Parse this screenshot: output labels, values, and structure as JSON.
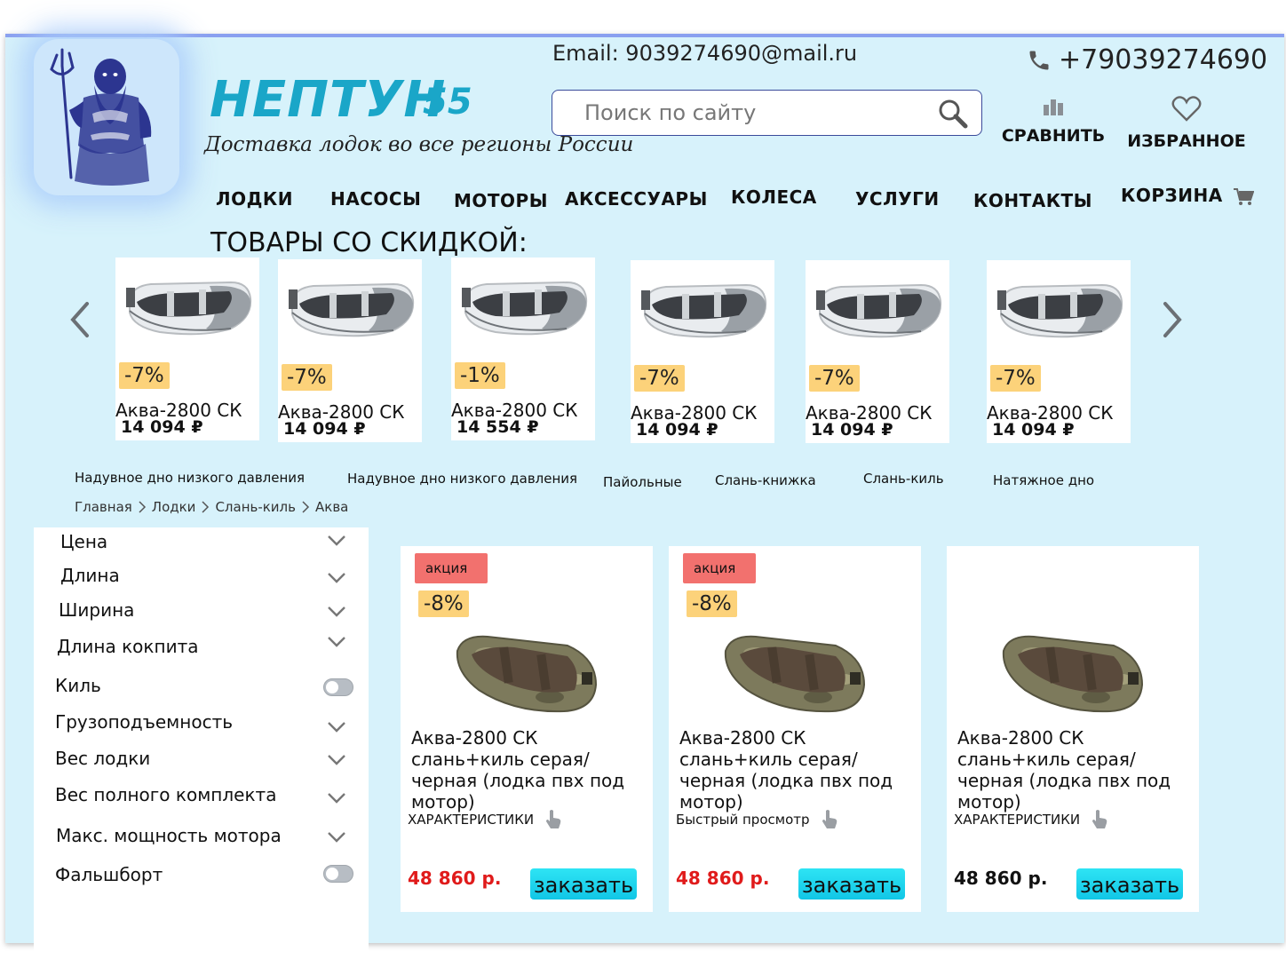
{
  "header": {
    "brand": "НЕПТУН",
    "brand_num": "55",
    "tagline": "Доставка лодок во все регионы России",
    "email": "Email: 9039274690@mail.ru",
    "phone": "+79039274690",
    "search_placeholder": "Поиск по сайту",
    "compare_label": "СРАВНИТЬ",
    "favorites_label": "ИЗБРАННОЕ"
  },
  "nav": {
    "items": [
      "ЛОДКИ",
      "НАСОСЫ",
      "МОТОРЫ",
      "АКСЕССУАРЫ",
      "КОЛЕСА",
      "УСЛУГИ",
      "КОНТАКТЫ",
      "КОРЗИНА"
    ]
  },
  "sale": {
    "title": "ТОВАРЫ СО СКИДКОЙ:",
    "products": [
      {
        "discount": "-7%",
        "name": "Аква-2800 СК",
        "price": "14 094 ₽"
      },
      {
        "discount": "-7%",
        "name": "Аква-2800 СК",
        "price": "14 094 ₽"
      },
      {
        "discount": "-1%",
        "name": "Аква-2800 СК",
        "price": "14 554 ₽"
      },
      {
        "discount": "-7%",
        "name": "Аква-2800 СК",
        "price": "14 094 ₽"
      },
      {
        "discount": "-7%",
        "name": "Аква-2800 СК",
        "price": "14 094 ₽"
      },
      {
        "discount": "-7%",
        "name": "Аква-2800 СК",
        "price": "14 094 ₽"
      }
    ]
  },
  "categories": [
    "Надувное дно низкого давления",
    "Надувное дно низкого давления",
    "Пайольные",
    "Слань-книжка",
    "Слань-киль",
    "Натяжное дно"
  ],
  "breadcrumb": [
    "Главная",
    "Лодки",
    "Слань-киль",
    "Аква"
  ],
  "filters": {
    "items": [
      {
        "label": "Цена",
        "type": "dropdown"
      },
      {
        "label": "Длина",
        "type": "dropdown"
      },
      {
        "label": "Ширина",
        "type": "dropdown"
      },
      {
        "label": "Длина кокпита",
        "type": "dropdown"
      },
      {
        "label": "Киль",
        "type": "toggle"
      },
      {
        "label": "Грузоподъемность",
        "type": "dropdown"
      },
      {
        "label": "Вес лодки",
        "type": "dropdown"
      },
      {
        "label": "Вес полного комплекта",
        "type": "dropdown"
      },
      {
        "label": "Макс. мощность мотора",
        "type": "dropdown"
      },
      {
        "label": "Фальшборт",
        "type": "toggle"
      }
    ]
  },
  "products": [
    {
      "badge": "акция",
      "discount": "-8%",
      "title": "Аква-2800 СК слань+киль серая/черная (лодка пвх под мотор)",
      "link": "ХАРАКТЕРИСТИКИ",
      "price": "48 860 р.",
      "price_color": "#e01b1b",
      "button": "заказать"
    },
    {
      "badge": "акция",
      "discount": "-8%",
      "title": "Аква-2800 СК слань+киль серая/черная (лодка пвх под мотор)",
      "link": "Быстрый просмотр",
      "price": "48 860 р.",
      "price_color": "#e01b1b",
      "button": "заказать"
    },
    {
      "badge": "",
      "discount": "",
      "title": "Аква-2800 СК слань+киль серая/черная (лодка пвх под мотор)",
      "link": "ХАРАКТЕРИСТИКИ",
      "price": "48 860 р.",
      "price_color": "#111111",
      "button": "заказать"
    }
  ],
  "colors": {
    "page_bg": "#d7f2fb",
    "brand": "#1aa6c8",
    "discount_badge": "#fcd27a",
    "akcia_badge": "#f2716e",
    "order_button": "#11c6e6",
    "sale_price": "#e01b1b"
  }
}
